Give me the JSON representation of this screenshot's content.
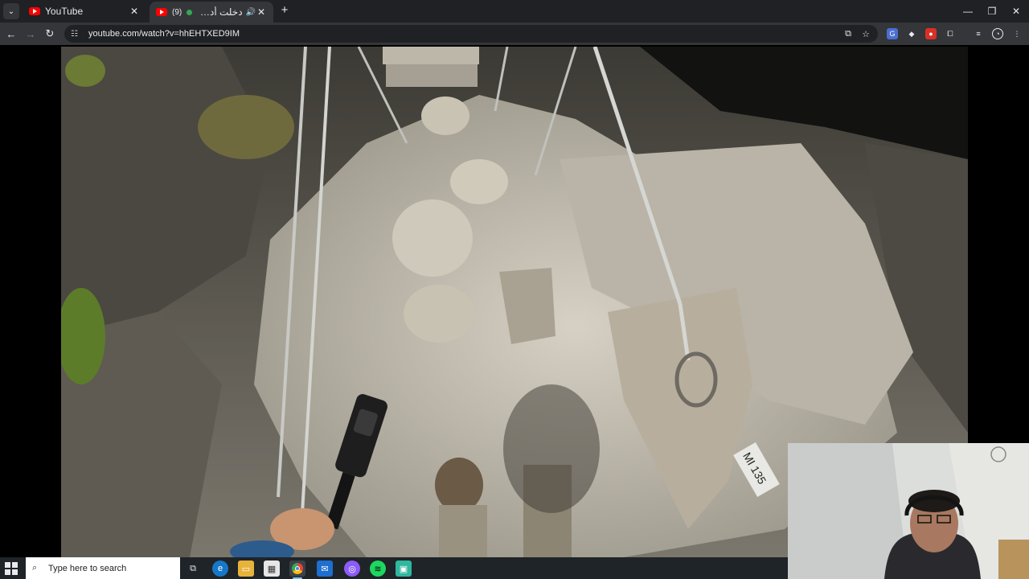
{
  "browser": {
    "tabs": [
      {
        "title": "YouTube",
        "active": false
      },
      {
        "title": "دخلت أدغال مدغشقر",
        "active": true,
        "prefix": "(9)"
      }
    ],
    "url": "youtube.com/watch?v=hhEHTXED9IM",
    "window_controls": {
      "minimize": "—",
      "restore": "❐",
      "close": "✕"
    },
    "new_tab_label": "+",
    "close_label": "✕"
  },
  "video": {
    "sign_text": "MI 135"
  },
  "taskbar": {
    "search_placeholder": "Type here to search"
  },
  "colors": {
    "tabstrip": "#202124",
    "toolbar": "#35363a",
    "youtube_red": "#ff0000",
    "taskbar": "#1f2428"
  },
  "icons": [
    "youtube-icon",
    "back-icon",
    "forward-icon",
    "reload-icon",
    "site-info-icon",
    "install-icon",
    "bookmark-star-icon",
    "extensions-icon",
    "profile-icon",
    "menu-icon",
    "windows-start-icon",
    "search-icon",
    "task-view-icon",
    "edge-icon",
    "file-explorer-icon",
    "store-icon",
    "chrome-icon",
    "mail-icon",
    "messenger-icon",
    "spotify-icon",
    "app-icon"
  ]
}
